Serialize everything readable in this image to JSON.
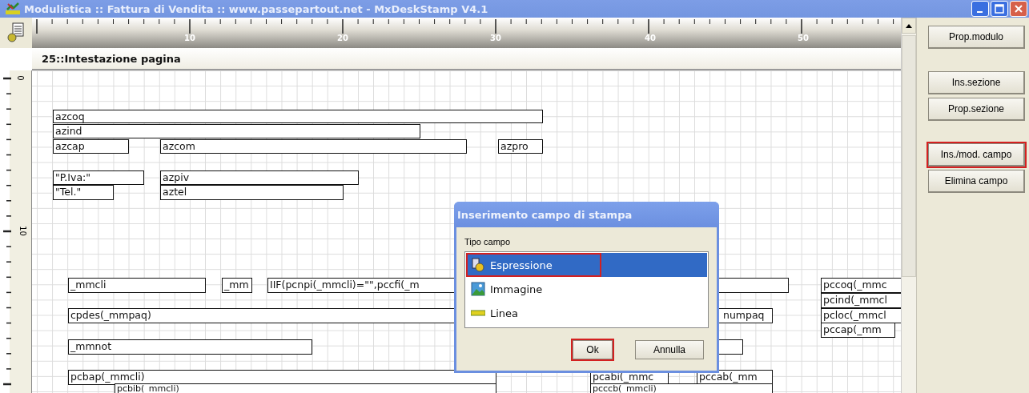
{
  "window": {
    "title": "Modulistica :: Fattura di Vendita :: www.passepartout.net - MxDeskStamp V4.1"
  },
  "ruler": {
    "horizontal_labels": [
      "10",
      "20",
      "30",
      "40",
      "50"
    ],
    "vertical_labels": [
      "0",
      "10"
    ]
  },
  "section": {
    "title": "25::Intestazione pagina"
  },
  "fields": [
    {
      "text": "azcoq"
    },
    {
      "text": "azind"
    },
    {
      "text": "azcap"
    },
    {
      "text": "azcom"
    },
    {
      "text": "azpro"
    },
    {
      "text": "\"P.Iva:\""
    },
    {
      "text": "azpiv"
    },
    {
      "text": "\"Tel.\""
    },
    {
      "text": "aztel"
    },
    {
      "text": "_mmcli"
    },
    {
      "text": "_mm"
    },
    {
      "text": "IIF(pcnpi(_mmcli)=\"\",pccfi(_m"
    },
    {
      "text": "pccoq(_mmc"
    },
    {
      "text": "pcind(_mmcl"
    },
    {
      "text": "cpdes(_mmpaq)"
    },
    {
      "text": "numpaq"
    },
    {
      "text": "pcloc(_mmcl"
    },
    {
      "text": "pccap(_mm"
    },
    {
      "text": "_mmnot"
    },
    {
      "text": "pcbap(_mmcli)"
    },
    {
      "text": "pcabi(_mmc"
    },
    {
      "text": "pccab(_mm"
    },
    {
      "text": "pcbib(_mmcli)"
    },
    {
      "text": "pcccb(_mmcli)"
    }
  ],
  "side_buttons": [
    {
      "label": "Prop.modulo",
      "annotated": false
    },
    {
      "label": "Ins.sezione",
      "annotated": false
    },
    {
      "label": "Prop.sezione",
      "annotated": false
    },
    {
      "label": "Ins./mod. campo",
      "annotated": true
    },
    {
      "label": "Elimina campo",
      "annotated": false
    }
  ],
  "dialog": {
    "title": "Inserimento campo di stampa",
    "list_label": "Tipo campo",
    "items": [
      {
        "label": "Espressione",
        "kind": "expression",
        "selected": true,
        "annotated": true
      },
      {
        "label": "Immagine",
        "kind": "image",
        "selected": false,
        "annotated": false
      },
      {
        "label": "Linea",
        "kind": "line",
        "selected": false,
        "annotated": false
      }
    ],
    "buttons": [
      {
        "label": "Ok",
        "annotated": true
      },
      {
        "label": "Annulla",
        "annotated": false
      }
    ]
  }
}
